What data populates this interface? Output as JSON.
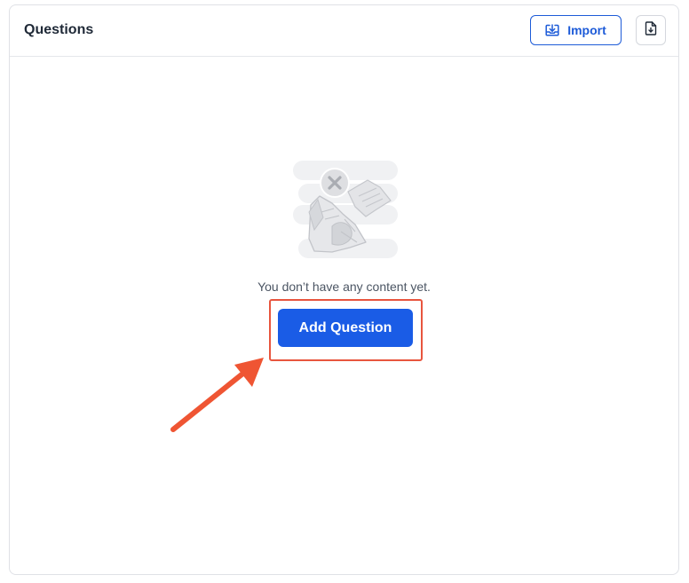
{
  "panel": {
    "title": "Questions"
  },
  "toolbar": {
    "import_label": "Import",
    "import_icon": "download-tray-icon",
    "export_icon": "file-download-icon"
  },
  "empty_state": {
    "illustration": "empty-content-illustration",
    "message": "You don’t have any content yet.",
    "add_label": "Add Question"
  },
  "annotation": {
    "highlight_color": "#e8553e",
    "arrow_color": "#ef5533"
  },
  "colors": {
    "primary": "#1a5ce6",
    "outline": "#1d5bd8",
    "border": "#dfe1e6"
  }
}
